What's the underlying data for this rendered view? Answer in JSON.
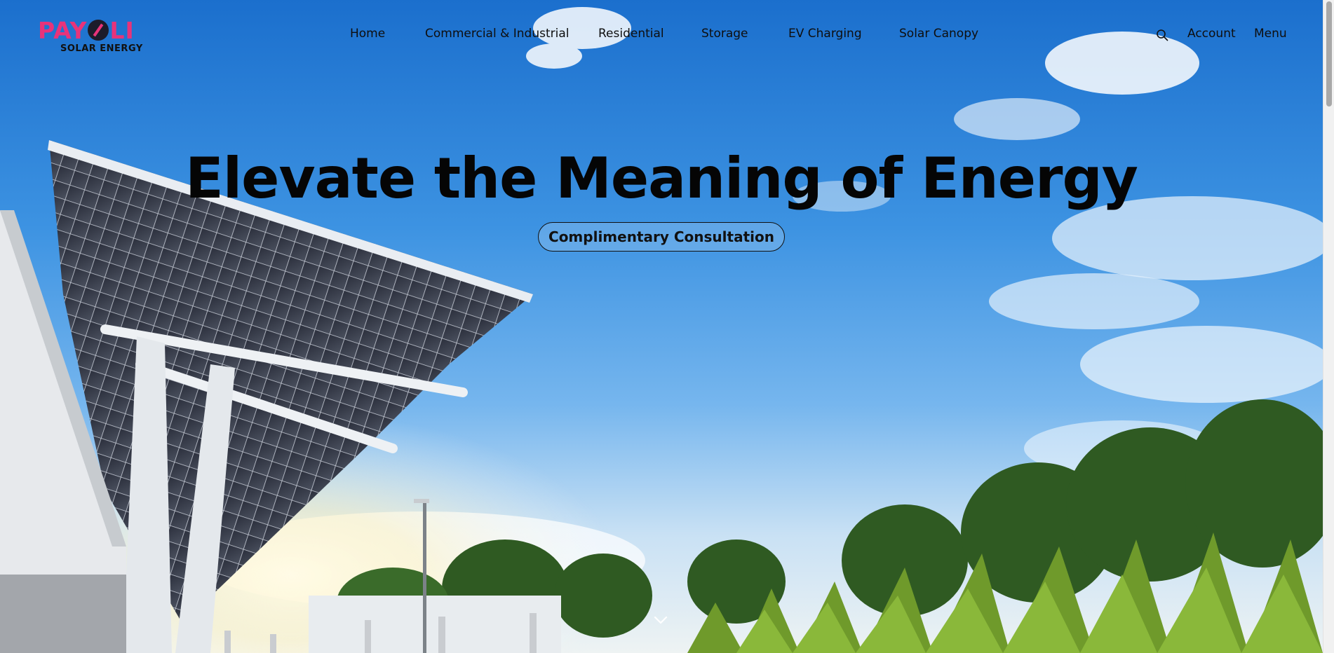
{
  "brand": {
    "name": "PAYOLI",
    "tagline": "SOLAR ENERGY",
    "color_primary": "#e8337a",
    "color_dark": "#1c1c2a"
  },
  "nav": {
    "items": [
      {
        "label": "Home"
      },
      {
        "label": "Commercial & Industrial"
      },
      {
        "label": "Residential"
      },
      {
        "label": "Storage"
      },
      {
        "label": "EV Charging"
      },
      {
        "label": "Solar Canopy"
      }
    ]
  },
  "right_nav": {
    "search_icon": "search-icon",
    "account_label": "Account",
    "menu_label": "Menu"
  },
  "hero": {
    "headline": "Elevate the Meaning of Energy",
    "cta_label": "Complimentary Consultation",
    "scroll_icon": "chevron-down-icon"
  }
}
